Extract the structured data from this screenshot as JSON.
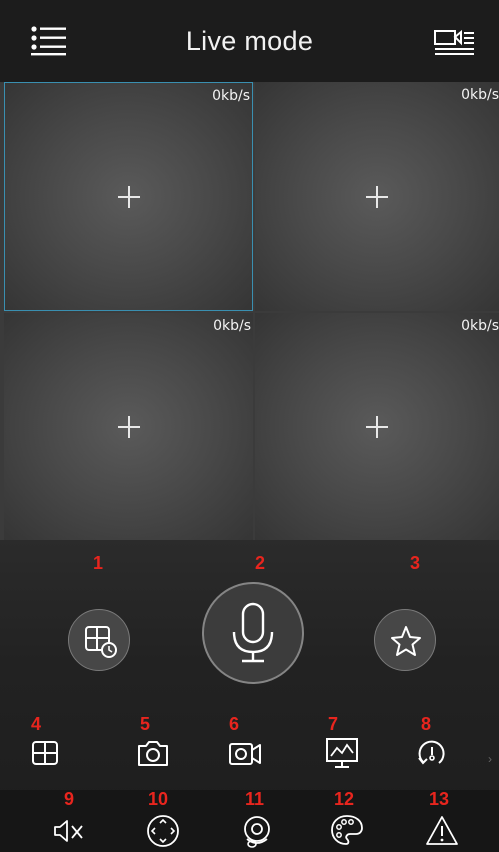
{
  "header": {
    "title": "Live mode",
    "menu_icon": "list-menu-icon",
    "right_icon": "camera-list-icon"
  },
  "grid": {
    "cells": [
      {
        "rate": "0kb/s",
        "selected": true
      },
      {
        "rate": "0kb/s",
        "selected": false
      },
      {
        "rate": "0kb/s",
        "selected": false
      },
      {
        "rate": "0kb/s",
        "selected": false
      }
    ],
    "selection_color": "#3a8fb0"
  },
  "markers": {
    "n1": "1",
    "n2": "2",
    "n3": "3",
    "n4": "4",
    "n5": "5",
    "n6": "6",
    "n7": "7",
    "n8": "8",
    "n9": "9",
    "n10": "10",
    "n11": "11",
    "n12": "12",
    "n13": "13",
    "color": "#e8251e"
  },
  "controls": {
    "main_buttons": [
      "playback-grid-icon",
      "microphone-icon",
      "star-icon"
    ],
    "toolbar_row1": [
      "split-screen-icon",
      "snapshot-camera-icon",
      "record-video-icon",
      "monitor-chart-icon",
      "history-clock-icon"
    ],
    "toolbar_row2": [
      "mute-speaker-icon",
      "ptz-direction-icon",
      "fisheye-icon",
      "palette-icon",
      "alarm-warning-icon"
    ],
    "more_arrow": "›"
  }
}
